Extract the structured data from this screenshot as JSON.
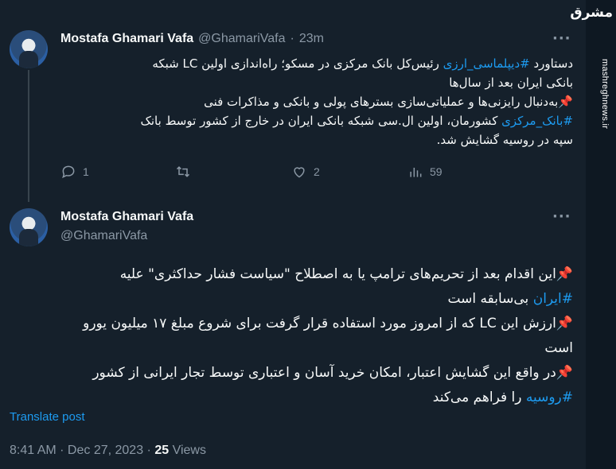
{
  "tweet1": {
    "name": "Mostafa Ghamari Vafa",
    "handle": "@GhamariVafa",
    "dot": "·",
    "time": "23m",
    "more": "···",
    "line1_a": "دستاورد ",
    "line1_tag": "#دیپلماسی_ارزی",
    "line1_b": " رئیس‌کل بانک مرکزی در مسکو؛ راه‌اندازی اولین LC شبکه",
    "line2": "بانکی ایران بعد از سال‌ها",
    "line3": "📌به‌دنبال رایزنی‌ها و عملیاتی‌سازی بسترهای پولی و بانکی و مذاکرات فنی",
    "line4_tag": "#بانک_مرکزی",
    "line4_b": " کشورمان، اولین ال.سی شبکه بانکی ایران در خارج از کشور توسط بانک",
    "line5": "سپه در روسیه گشایش شد.",
    "reply_count": "1",
    "retweet_count": "",
    "like_count": "2",
    "views_count": "59"
  },
  "tweet2": {
    "name": "Mostafa Ghamari Vafa",
    "handle": "@GhamariVafa",
    "more": "···",
    "p1_a": "📌این اقدام بعد از تحریم‌های ترامپ یا به اصطلاح \"سیاست فشار حداکثری\" علیه",
    "p1_tag": "#ایران",
    "p1_b": " بی‌سابقه است",
    "p2_a": "📌ارزش این LC که از امروز مورد استفاده قرار گرفت برای شروع مبلغ ۱۷ میلیون یورو",
    "p2_b": "است",
    "p3_a": "📌در واقع این گشایش اعتبار، امکان خرید آسان و اعتباری توسط تجار ایرانی از کشور",
    "p3_tag": "#روسیه",
    "p3_b": " را فراهم می‌کند",
    "translate": "Translate post",
    "timestamp": "8:41 AM · Dec 27, 2023 · ",
    "views": "25",
    "views_label": " Views"
  },
  "watermark": {
    "logo": "مشرق",
    "site": "mashreghnews.ir"
  },
  "colors": {
    "background": "#15202b",
    "text": "#f7f9f9",
    "muted": "#8b98a5",
    "link": "#1d9bf0"
  }
}
